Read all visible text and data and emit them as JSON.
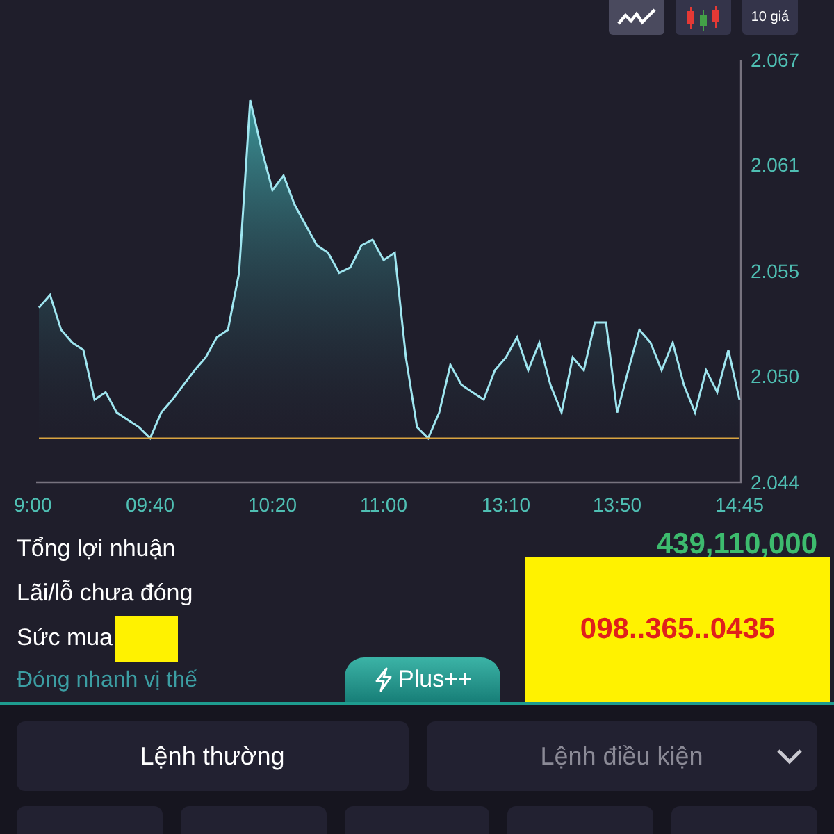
{
  "toolbar": [
    {
      "kind": "line",
      "selected": true
    },
    {
      "kind": "candles",
      "selected": false
    },
    {
      "kind": "text",
      "label": "10 giá",
      "selected": false
    }
  ],
  "chart": {
    "chart_data": {
      "type": "area",
      "categories": [
        "9:00",
        null,
        null,
        null,
        null,
        null,
        null,
        null,
        null,
        null,
        "09:40",
        null,
        null,
        null,
        null,
        null,
        null,
        null,
        null,
        null,
        null,
        "10:20",
        null,
        null,
        null,
        null,
        null,
        null,
        null,
        null,
        null,
        "11:00",
        null,
        null,
        null,
        null,
        null,
        null,
        null,
        null,
        null,
        null,
        "13:10",
        null,
        null,
        null,
        null,
        null,
        null,
        null,
        null,
        null,
        "13:50",
        null,
        null,
        null,
        null,
        null,
        null,
        null,
        null,
        null,
        null,
        "14:45"
      ],
      "series": [
        {
          "color": "#9fe6f0",
          "values": [
            2.0535,
            2.0542,
            2.0523,
            2.0516,
            2.0512,
            2.0485,
            2.0489,
            2.0478,
            2.0474,
            2.047,
            2.0464,
            2.0478,
            2.0485,
            2.0493,
            2.0501,
            2.0508,
            2.0519,
            2.0523,
            2.0554,
            2.0648,
            2.0622,
            2.0599,
            2.0607,
            2.0591,
            2.058,
            2.0569,
            2.0565,
            2.0554,
            2.0557,
            2.0569,
            2.0572,
            2.0561,
            2.0565,
            2.0508,
            2.047,
            2.0464,
            2.0478,
            2.0504,
            2.0493,
            2.0489,
            2.0485,
            2.0501,
            2.0508,
            2.0519,
            2.0501,
            2.0516,
            2.0493,
            2.0478,
            2.0508,
            2.0501,
            2.0527,
            2.0527,
            2.0478,
            2.0501,
            2.0523,
            2.0516,
            2.0501,
            2.0516,
            2.0493,
            2.0478,
            2.0501,
            2.0489,
            2.0512,
            2.0485
          ]
        },
        {
          "type": "line",
          "color": "#d9a441",
          "values": [
            2.0464,
            2.0464,
            2.0464,
            2.0464,
            2.0464,
            2.0464,
            2.0464,
            2.0464,
            2.0464,
            2.0464,
            2.0464,
            2.0464,
            2.0464,
            2.0464,
            2.0464,
            2.0464,
            2.0464,
            2.0464,
            2.0464,
            2.0464,
            2.0464,
            2.0464,
            2.0464,
            2.0464,
            2.0464,
            2.0464,
            2.0464,
            2.0464,
            2.0464,
            2.0464,
            2.0464,
            2.0464,
            2.0464,
            2.0464,
            2.0464,
            2.0464,
            2.0464,
            2.0464,
            2.0464,
            2.0464,
            2.0464,
            2.0464,
            2.0464,
            2.0464,
            2.0464,
            2.0464,
            2.0464,
            2.0464,
            2.0464,
            2.0464,
            2.0464,
            2.0464,
            2.0464,
            2.0464,
            2.0464,
            2.0464,
            2.0464,
            2.0464,
            2.0464,
            2.0464,
            2.0464,
            2.0464,
            2.0464,
            2.0464
          ]
        }
      ],
      "ylim": [
        2.044,
        2.067
      ],
      "yticks": [
        {
          "value": 2.067,
          "label": "2.067"
        },
        {
          "value": 2.0613,
          "label": "2.061"
        },
        {
          "value": 2.0555,
          "label": "2.055"
        },
        {
          "value": 2.0498,
          "label": "2.050"
        },
        {
          "value": 2.044,
          "label": "2.044"
        }
      ]
    }
  },
  "summary": [
    {
      "label": "Tổng lợi nhuận",
      "value": "439,110,000"
    },
    {
      "label": "Lãi/lỗ chưa đóng"
    },
    {
      "label": "Sức mua",
      "redacted": true
    }
  ],
  "quick_close_link": "Đóng nhanh vị thế",
  "plus_tab": "Plus++",
  "overlay_note": "098..365..0435",
  "order_tabs": [
    {
      "label": "Lệnh thường",
      "selected": true,
      "dropdown": false
    },
    {
      "label": "Lệnh điều kiện",
      "selected": false,
      "dropdown": true
    }
  ],
  "order_buttons": [
    {
      "kind": "blank"
    },
    {
      "kind": "blank"
    },
    {
      "kind": "blank"
    },
    {
      "kind": "blank"
    },
    {
      "kind": "blank"
    }
  ]
}
